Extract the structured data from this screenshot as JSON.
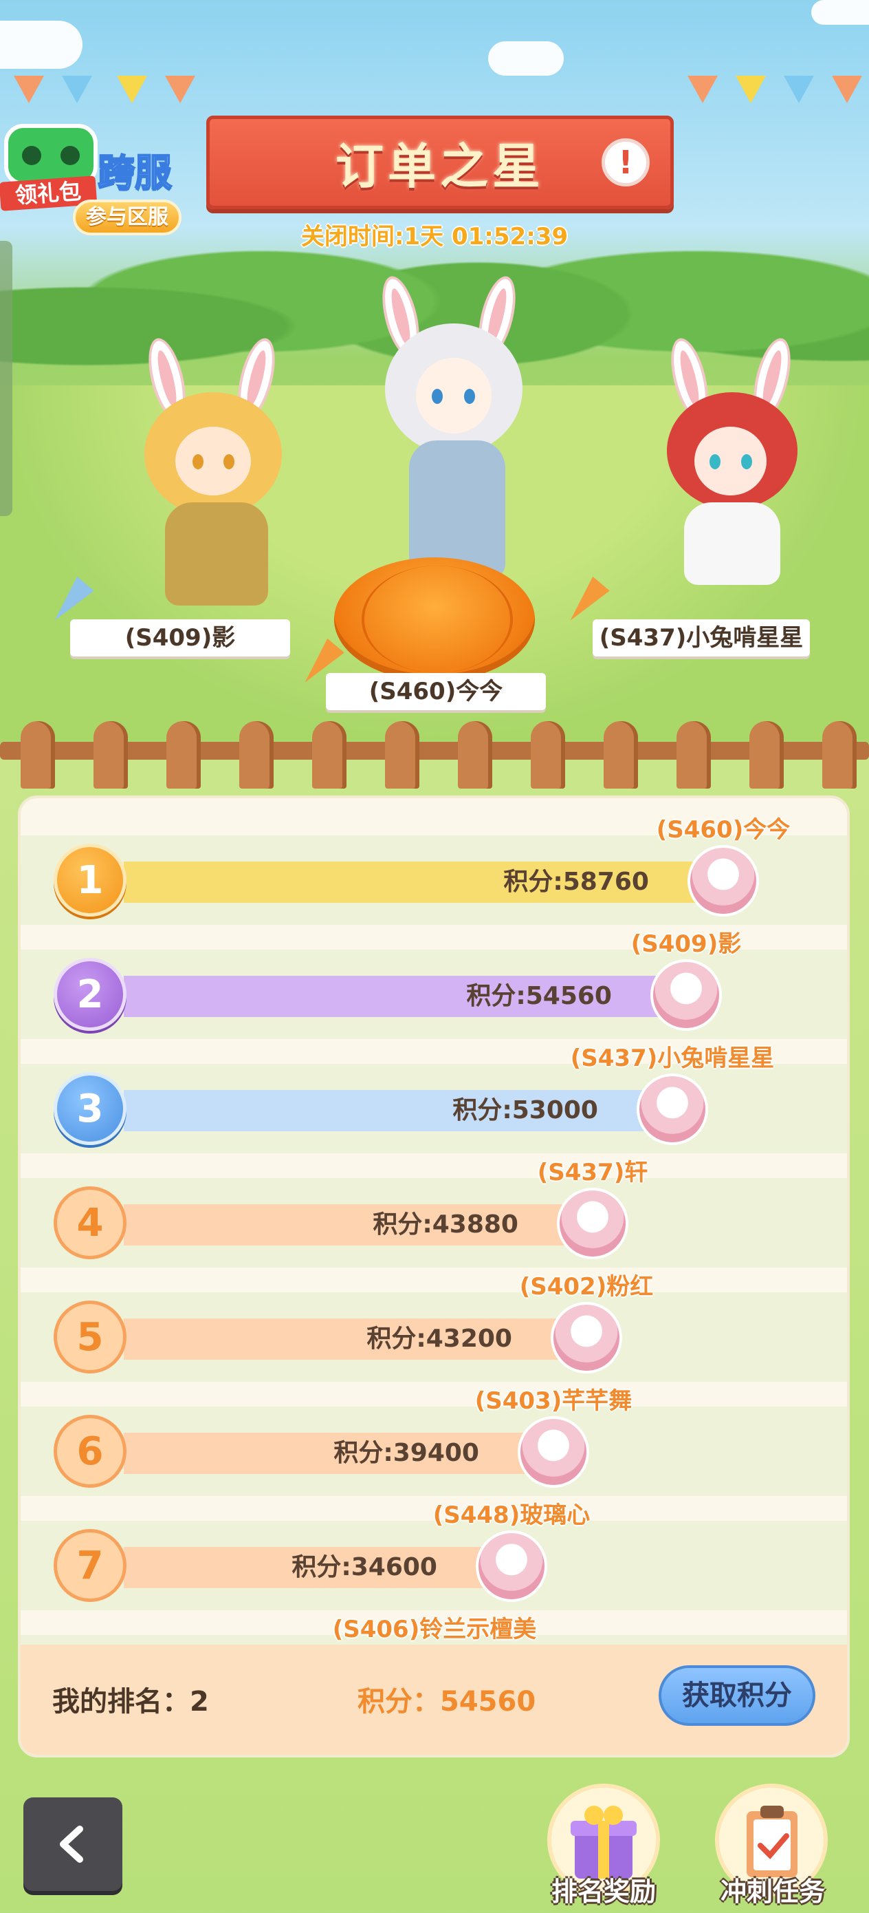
{
  "header": {
    "title": "订单之星",
    "close_time": "关闭时间:1天 01:52:39",
    "gift_label": "领礼包",
    "cross_server": "跨服",
    "join_server_button": "参与区服",
    "info_icon": "exclamation-icon"
  },
  "podium": {
    "first": "(S460)今今",
    "second": "(S409)影",
    "third": "(S437)小兔啃星星"
  },
  "ranking": [
    {
      "rank": "1",
      "player": "(S460)今今",
      "score": "积分:58760",
      "value": 58760,
      "style": "gold",
      "bar_color": "#f7dc6f"
    },
    {
      "rank": "2",
      "player": "(S409)影",
      "score": "积分:54560",
      "value": 54560,
      "style": "purple",
      "bar_color": "#d4b3f5"
    },
    {
      "rank": "3",
      "player": "(S437)小兔啃星星",
      "score": "积分:53000",
      "value": 53000,
      "style": "blue",
      "bar_color": "#c4ddf8"
    },
    {
      "rank": "4",
      "player": "(S437)轩",
      "score": "积分:43880",
      "value": 43880,
      "style": "plain",
      "bar_color": "#fdd3b0"
    },
    {
      "rank": "5",
      "player": "(S402)粉红",
      "score": "积分:43200",
      "value": 43200,
      "style": "plain",
      "bar_color": "#fdd3b0"
    },
    {
      "rank": "6",
      "player": "(S403)芊芊舞",
      "score": "积分:39400",
      "value": 39400,
      "style": "plain",
      "bar_color": "#fdd3b0"
    },
    {
      "rank": "7",
      "player": "(S448)玻璃心",
      "score": "积分:34600",
      "value": 34600,
      "style": "plain",
      "bar_color": "#fdd3b0"
    },
    {
      "rank": "",
      "player": "(S406)铃兰示檀美",
      "score": "",
      "value": 0,
      "style": "plain",
      "bar_color": "#fdd3b0"
    }
  ],
  "my_rank": {
    "rank_label": "我的排名：2",
    "score_label": "积分：54560",
    "get_points_button": "获取积分"
  },
  "bottom": {
    "back_icon": "chevron-left-icon",
    "rank_reward": "排名奖励",
    "sprint_task": "冲刺任务"
  }
}
